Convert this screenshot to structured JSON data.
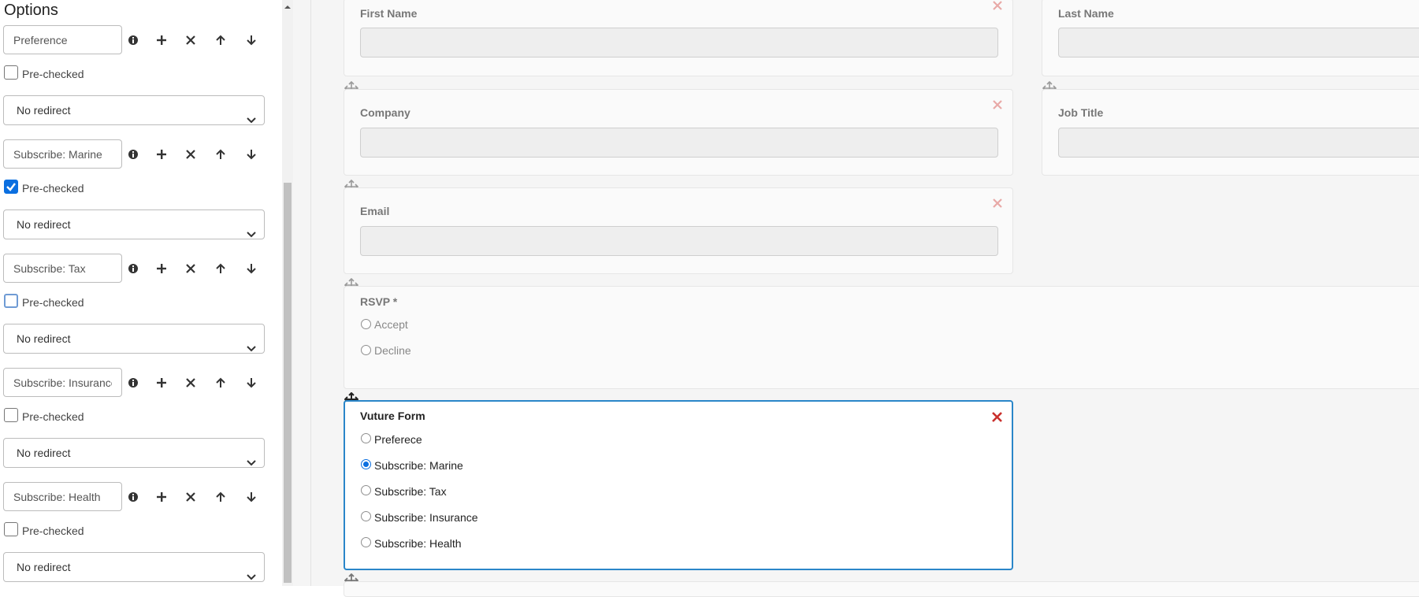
{
  "options_panel": {
    "title": "Options",
    "items": [
      {
        "value": "Preference",
        "prechecked_label": "Pre-checked",
        "prechecked": false,
        "redirect": "No redirect"
      },
      {
        "value": "Subscribe: Marine",
        "prechecked_label": "Pre-checked",
        "prechecked": true,
        "redirect": "No redirect"
      },
      {
        "value": "Subscribe: Tax",
        "prechecked_label": "Pre-checked",
        "prechecked": false,
        "redirect": "No redirect"
      },
      {
        "value": "Subscribe: Insurance",
        "prechecked_label": "Pre-checked",
        "prechecked": false,
        "redirect": "No redirect"
      },
      {
        "value": "Subscribe: Health",
        "prechecked_label": "Pre-checked",
        "prechecked": false,
        "redirect": "No redirect"
      }
    ],
    "tool_icons": [
      "info-icon",
      "plus-icon",
      "close-icon",
      "arrow-up-icon",
      "arrow-down-icon"
    ]
  },
  "form": {
    "fields": {
      "first_name": "First Name",
      "last_name": "Last Name",
      "company": "Company",
      "job_title": "Job Title",
      "email": "Email"
    },
    "rsvp": {
      "label": "RSVP *",
      "options": [
        "Accept",
        "Decline"
      ]
    },
    "vuture": {
      "label": "Vuture Form",
      "options": [
        "Preferece",
        "Subscribe: Marine",
        "Subscribe: Tax",
        "Subscribe: Insurance",
        "Subscribe: Health"
      ],
      "selected_index": 1
    }
  },
  "colors": {
    "accent": "#0b6fe0",
    "selected_border": "#2a86c9",
    "remove_active": "#c9302c",
    "remove_inactive": "#e8a9a7"
  }
}
